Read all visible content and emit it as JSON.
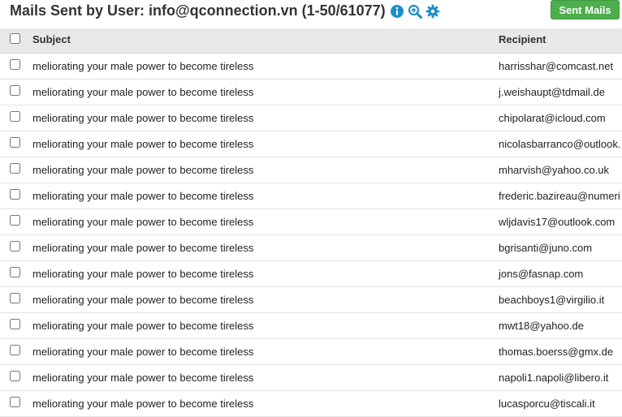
{
  "header": {
    "title": "Mails Sent by User: info@qconnection.vn (1-50/61077)",
    "icons": [
      "info-icon",
      "zoom-in-icon",
      "gear-icon"
    ],
    "sent_mails_label": "Sent Mails"
  },
  "table": {
    "columns": {
      "subject": "Subject",
      "recipient": "Recipient"
    },
    "rows": [
      {
        "subject": "meliorating your male power to become tireless",
        "recipient": "harrisshar@comcast.net"
      },
      {
        "subject": "meliorating your male power to become tireless",
        "recipient": "j.weishaupt@tdmail.de"
      },
      {
        "subject": "meliorating your male power to become tireless",
        "recipient": "chipolarat@icloud.com"
      },
      {
        "subject": "meliorating your male power to become tireless",
        "recipient": "nicolasbarranco@outlook."
      },
      {
        "subject": "meliorating your male power to become tireless",
        "recipient": "mharvish@yahoo.co.uk"
      },
      {
        "subject": "meliorating your male power to become tireless",
        "recipient": "frederic.bazireau@numeri"
      },
      {
        "subject": "meliorating your male power to become tireless",
        "recipient": "wljdavis17@outlook.com"
      },
      {
        "subject": "meliorating your male power to become tireless",
        "recipient": "bgrisanti@juno.com"
      },
      {
        "subject": "meliorating your male power to become tireless",
        "recipient": "jons@fasnap.com"
      },
      {
        "subject": "meliorating your male power to become tireless",
        "recipient": "beachboys1@virgilio.it"
      },
      {
        "subject": "meliorating your male power to become tireless",
        "recipient": "mwt18@yahoo.de"
      },
      {
        "subject": "meliorating your male power to become tireless",
        "recipient": "thomas.boerss@gmx.de"
      },
      {
        "subject": "meliorating your male power to become tireless",
        "recipient": "napoli1.napoli@libero.it"
      },
      {
        "subject": "meliorating your male power to become tireless",
        "recipient": "lucasporcu@tiscali.it"
      }
    ]
  },
  "colors": {
    "accent_icon": "#1e8fc6",
    "button_green": "#4cae4c",
    "header_bg": "#e8e8e8"
  }
}
